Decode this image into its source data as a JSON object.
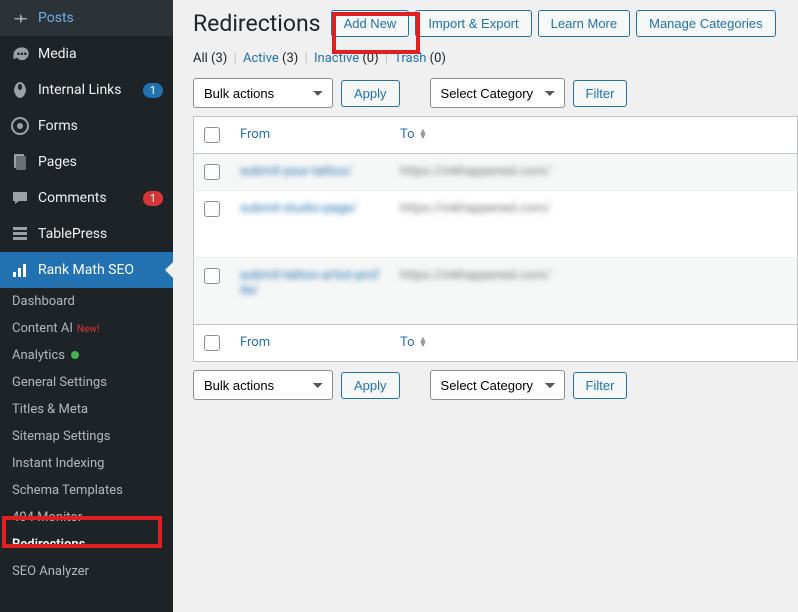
{
  "sidebar": {
    "items": [
      {
        "label": "Posts",
        "icon": "pin"
      },
      {
        "label": "Media",
        "icon": "media"
      },
      {
        "label": "Internal Links",
        "icon": "internal-links",
        "badge_blue": "1"
      },
      {
        "label": "Forms",
        "icon": "forms"
      },
      {
        "label": "Pages",
        "icon": "pages"
      },
      {
        "label": "Comments",
        "icon": "comments",
        "badge_red": "1"
      },
      {
        "label": "TablePress",
        "icon": "tablepress"
      },
      {
        "label": "Rank Math SEO",
        "icon": "rankmath",
        "active": true
      }
    ],
    "sub_items": [
      {
        "label": "Dashboard"
      },
      {
        "label": "Content AI",
        "new": "New!"
      },
      {
        "label": "Analytics",
        "dot": true
      },
      {
        "label": "General Settings"
      },
      {
        "label": "Titles & Meta"
      },
      {
        "label": "Sitemap Settings"
      },
      {
        "label": "Instant Indexing"
      },
      {
        "label": "Schema Templates"
      },
      {
        "label": "404 Monitor"
      },
      {
        "label": "Redirections",
        "current": true
      },
      {
        "label": "SEO Analyzer"
      }
    ]
  },
  "header": {
    "title": "Redirections",
    "buttons": {
      "add_new": "Add New",
      "import_export": "Import & Export",
      "learn_more": "Learn More",
      "manage_categories": "Manage Categories"
    }
  },
  "tabs": {
    "all": {
      "label": "All",
      "count": "(3)"
    },
    "active": {
      "label": "Active",
      "count": "(3)"
    },
    "inactive": {
      "label": "Inactive",
      "count": "(0)"
    },
    "trash": {
      "label": "Trash",
      "count": "(0)"
    }
  },
  "actions": {
    "bulk": "Bulk actions",
    "apply": "Apply",
    "select_category": "Select Category",
    "filter": "Filter"
  },
  "table": {
    "cols": {
      "from": "From",
      "to": "To"
    },
    "rows": [
      {
        "from": "submit-your-tattoo/",
        "to": "https://inkhappened.com/"
      },
      {
        "from": "submit-studio-page/",
        "to": "https://inkhappened.com/"
      },
      {
        "from": "submit-tattoo-artist-profile/",
        "to": "https://inkhappened.com/"
      }
    ]
  },
  "highlights": {
    "add_new_box": true,
    "redirections_box": true
  }
}
